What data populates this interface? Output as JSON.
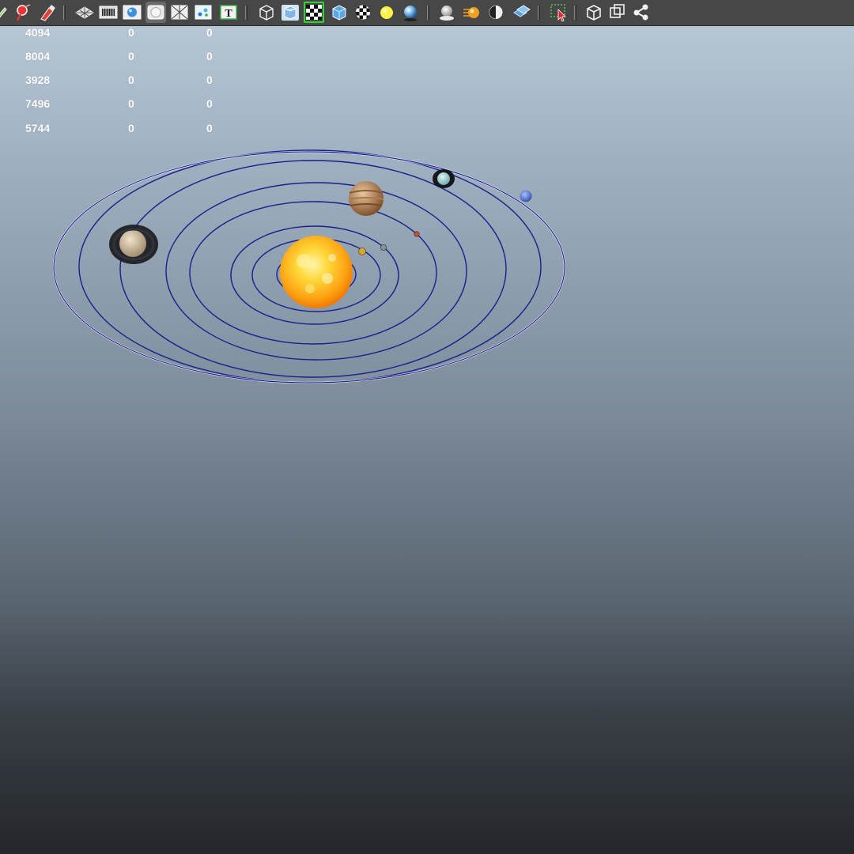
{
  "toolbar": {
    "icons": [
      "select-tool-icon",
      "lasso-tool-icon",
      "paint-tool-icon",
      "grid-toggle-icon",
      "film-gate-icon",
      "shaded-sphere-icon",
      "isolate-select-icon",
      "xray-icon",
      "uv-shell-icon",
      "text-icon",
      "wireframe-cube-icon",
      "smooth-shade-icon",
      "checker-texture-icon",
      "default-material-icon",
      "checker-ball-icon",
      "light-bulb-icon",
      "reflection-sphere-icon",
      "ambient-occlusion-icon",
      "motion-blur-icon",
      "half-shade-icon",
      "xray-joints-icon",
      "select-highlight-icon",
      "bounding-box-icon",
      "two-sided-lighting-icon",
      "node-graph-icon"
    ]
  },
  "hud": {
    "rows": [
      [
        "4094",
        "0",
        "0"
      ],
      [
        "8004",
        "0",
        "0"
      ],
      [
        "3928",
        "0",
        "0"
      ],
      [
        "7496",
        "0",
        "0"
      ],
      [
        "5744",
        "0",
        "0"
      ]
    ]
  },
  "scene": {
    "background_top": "#bccbd8",
    "background_bottom": "#23262a",
    "orbit_color": "#1a1f8a",
    "sun_color": "#ffb31a",
    "planets": [
      "mercury",
      "venus",
      "earth",
      "mars",
      "jupiter",
      "saturn",
      "uranus",
      "neptune"
    ]
  }
}
